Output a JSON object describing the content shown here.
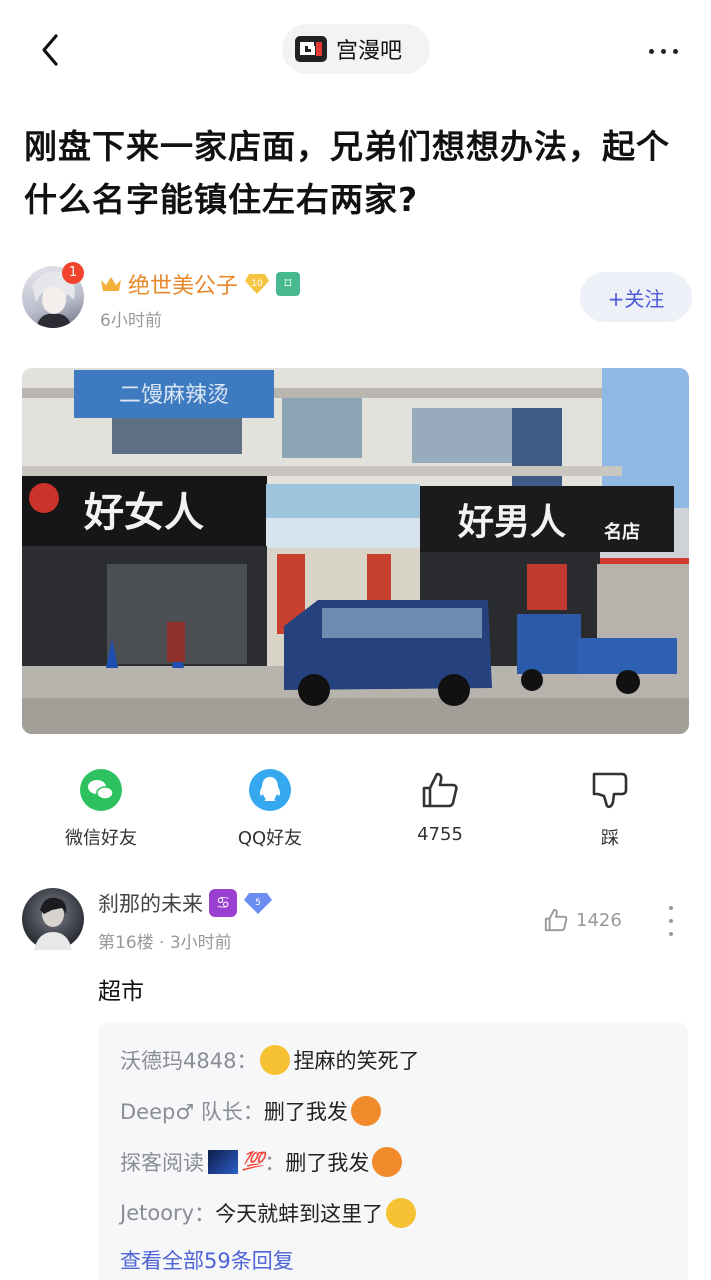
{
  "topbar": {
    "forum_name": "宫漫吧"
  },
  "post": {
    "title": "刚盘下来一家店面，兄弟们想想办法，起个什么名字能镇住左右两家?",
    "author": {
      "name": "绝世美公子",
      "notification_count": "1",
      "level": "10",
      "time": "6小时前",
      "follow_label": "+关注"
    },
    "photo": {
      "sign_top": "二馒麻辣烫",
      "sign_left": "好女人",
      "sign_right": "好男人",
      "sign_right_suffix": "名店"
    },
    "actions": {
      "wechat": "微信好友",
      "qq": "QQ好友",
      "likes": "4755",
      "dislike": "踩"
    }
  },
  "comment": {
    "user": "刹那的未来",
    "level": "5",
    "floor": "第16楼",
    "dot": "·",
    "time": "3小时前",
    "likes": "1426",
    "text": "超市",
    "replies": [
      {
        "user": "沃德玛4848",
        "sep": "：",
        "text": "捏麻的笑死了",
        "emoji_pos": "before",
        "emoji_color": "#f6c233"
      },
      {
        "user": "Deep♂ 队长",
        "sep": "：",
        "text": "删了我发",
        "emoji_pos": "after",
        "emoji_color": "#f08a2a"
      },
      {
        "user": "探客阅读",
        "sep": "：",
        "text": "删了我发",
        "emoji_pos": "after",
        "emoji_color": "#f08a2a",
        "badge": "💯"
      },
      {
        "user": "Jetoory",
        "sep": "：",
        "text": "今天就蚌到这里了",
        "emoji_pos": "after",
        "emoji_color": "#f6c233"
      }
    ],
    "view_all": "查看全部59条回复"
  },
  "colors": {
    "accent_blue": "#4a5ad8",
    "author_orange": "#e7892a",
    "wechat_green": "#2dc160",
    "qq_blue": "#35a8ef"
  }
}
